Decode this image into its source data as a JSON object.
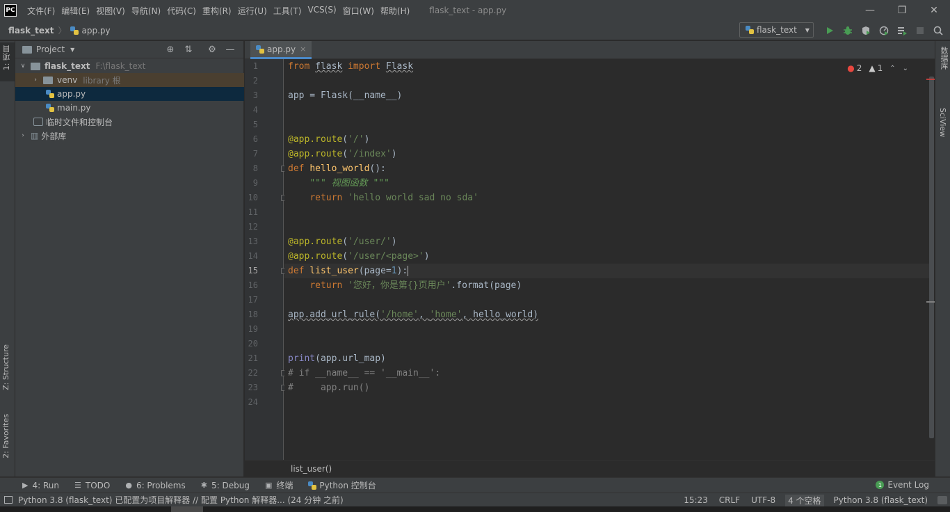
{
  "menubar": {
    "logo": "PC",
    "items": [
      "文件(F)",
      "编辑(E)",
      "视图(V)",
      "导航(N)",
      "代码(C)",
      "重构(R)",
      "运行(U)",
      "工具(T)",
      "VCS(S)",
      "窗口(W)",
      "帮助(H)"
    ],
    "window_title": "flask_text - app.py",
    "minimize": "—",
    "restore": "❐",
    "close": "✕"
  },
  "navbar": {
    "project": "flask_text",
    "separator": "〉",
    "file": "app.py",
    "run_config": "flask_text",
    "run_config_caret": "▼",
    "tools": [
      "run-icon",
      "debug-icon",
      "coverage-icon",
      "profile-icon",
      "build-icon",
      "stop-icon",
      "search-icon"
    ]
  },
  "left_strip": {
    "project_tab": "1: 项目",
    "structure_tab": "Z: Structure",
    "favorites_tab": "2: Favorites"
  },
  "right_strip": {
    "database_tab": "数据库",
    "sciview_tab": "SciView"
  },
  "project_panel": {
    "title": "Project",
    "caret": "▼",
    "tree": [
      {
        "label": "flask_text",
        "hint": "F:\\flask_text",
        "arrow": "∨"
      },
      {
        "label": "venv",
        "hint": "library 根",
        "arrow": "›"
      },
      {
        "label": "app.py",
        "hint": "",
        "arrow": ""
      },
      {
        "label": "main.py",
        "hint": "",
        "arrow": ""
      },
      {
        "label": "临时文件和控制台",
        "hint": "",
        "arrow": ""
      },
      {
        "label": "外部库",
        "hint": "",
        "arrow": "›"
      }
    ]
  },
  "editor": {
    "tab_label": "app.py",
    "tab_close": "×",
    "current_line": 15,
    "line_numbers": [
      "1",
      "2",
      "3",
      "4",
      "5",
      "6",
      "7",
      "8",
      "9",
      "10",
      "11",
      "12",
      "13",
      "14",
      "15",
      "16",
      "17",
      "18",
      "19",
      "20",
      "21",
      "22",
      "23",
      "24"
    ],
    "inspection": {
      "errors": "2",
      "warnings": "1"
    },
    "breadcrumb": "list_user()"
  },
  "tool_windows": {
    "run": "4: Run",
    "todo": "TODO",
    "problems": "6: Problems",
    "debug": "5: Debug",
    "terminal": "终端",
    "python_console": "Python 控制台",
    "event_log": "Event Log"
  },
  "statusbar": {
    "message": "Python 3.8 (flask_text) 已配置为项目解释器 // 配置 Python 解释器... (24 分钟 之前)",
    "position": "15:23",
    "line_separator": "CRLF",
    "encoding": "UTF-8",
    "indent": "4 个空格",
    "interpreter": "Python 3.8 (flask_text)"
  }
}
